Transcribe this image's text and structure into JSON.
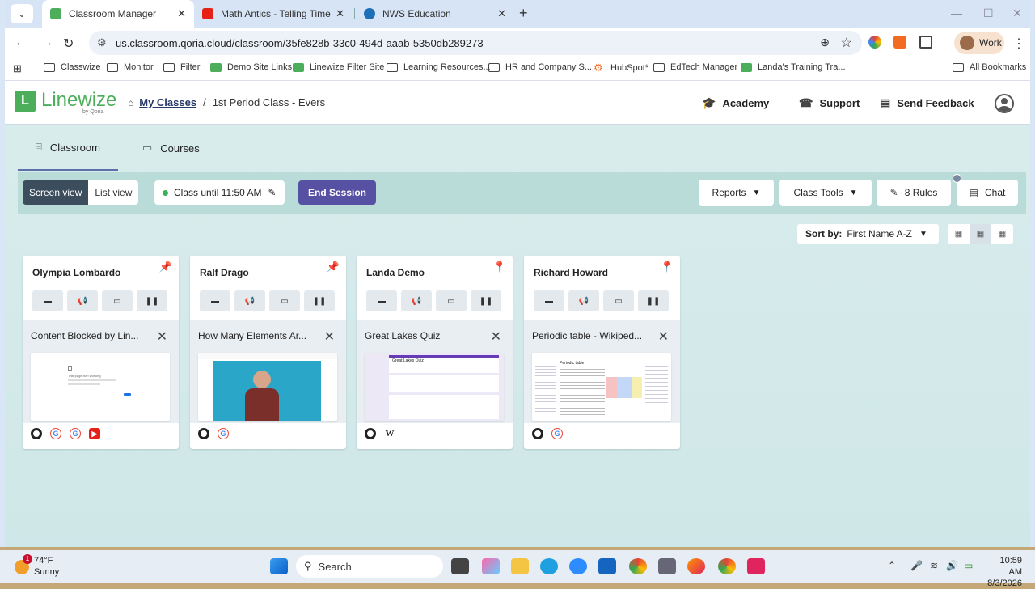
{
  "browser": {
    "tabs": [
      {
        "title": "Classroom Manager",
        "favicon": "linewize-icon",
        "color": "#4cae5b"
      },
      {
        "title": "Math Antics - Telling Time - You",
        "favicon": "youtube-icon",
        "color": "#e62117"
      },
      {
        "title": "NWS Education",
        "favicon": "nws-icon",
        "color": "#1d6fb8"
      }
    ],
    "url": "us.classroom.qoria.cloud/classroom/35fe828b-33c0-494d-aaab-5350db289273",
    "profile": "Work",
    "bookmarks": [
      {
        "label": "Classwize",
        "icon": "folder-icon"
      },
      {
        "label": "Monitor",
        "icon": "folder-icon"
      },
      {
        "label": "Filter",
        "icon": "folder-icon"
      },
      {
        "label": "Demo Site Links",
        "icon": "linewize-icon"
      },
      {
        "label": "Linewize Filter Site",
        "icon": "linewize-icon"
      },
      {
        "label": "Learning Resources...",
        "icon": "folder-icon"
      },
      {
        "label": "HR and Company S...",
        "icon": "folder-icon"
      },
      {
        "label": "HubSpot*",
        "icon": "hubspot-icon"
      },
      {
        "label": "EdTech Manager",
        "icon": "folder-icon"
      },
      {
        "label": "Landa's Training Tra...",
        "icon": "linewize-icon"
      }
    ],
    "all_bookmarks": "All Bookmarks"
  },
  "app": {
    "logo_text": "Linewize",
    "logo_sub": "by Qoria",
    "breadcrumb_link": "My Classes",
    "breadcrumb_sep": "/",
    "breadcrumb_current": "1st Period Class - Evers",
    "header_links": {
      "academy": "Academy",
      "support": "Support",
      "feedback": "Send Feedback"
    },
    "page_tabs": {
      "classroom": "Classroom",
      "courses": "Courses"
    },
    "toolbar": {
      "screen_view": "Screen view",
      "list_view": "List view",
      "class_until": "Class until 11:50 AM",
      "end_session": "End Session",
      "reports": "Reports",
      "class_tools": "Class Tools",
      "rules": "8 Rules",
      "chat": "Chat"
    },
    "sort": {
      "label": "Sort by:",
      "value": "First Name A-Z"
    },
    "students": [
      {
        "name": "Olympia Lombardo",
        "pinned": true,
        "site": "Content Blocked by Lin...",
        "thumb": "blocked",
        "favicons": [
          "chrome",
          "google",
          "google",
          "youtube"
        ]
      },
      {
        "name": "Ralf Drago",
        "pinned": true,
        "site": "How Many Elements Ar...",
        "thumb": "video",
        "favicons": [
          "chrome",
          "google"
        ]
      },
      {
        "name": "Landa Demo",
        "pinned": false,
        "site": "Great Lakes Quiz",
        "thumb": "quiz",
        "favicons": [
          "chrome",
          "wikipedia"
        ]
      },
      {
        "name": "Richard Howard",
        "pinned": false,
        "site": "Periodic table - Wikiped...",
        "thumb": "wiki",
        "favicons": [
          "chrome",
          "google"
        ]
      }
    ],
    "quiz_title": "Great Lakes Quiz",
    "blocked_text": "This page isn't working",
    "wiki_title": "Periodic table"
  },
  "taskbar": {
    "weather_temp": "74°F",
    "weather_desc": "Sunny",
    "badge": "1",
    "search": "Search",
    "time": "10:59 AM",
    "date": "8/3/2026"
  }
}
